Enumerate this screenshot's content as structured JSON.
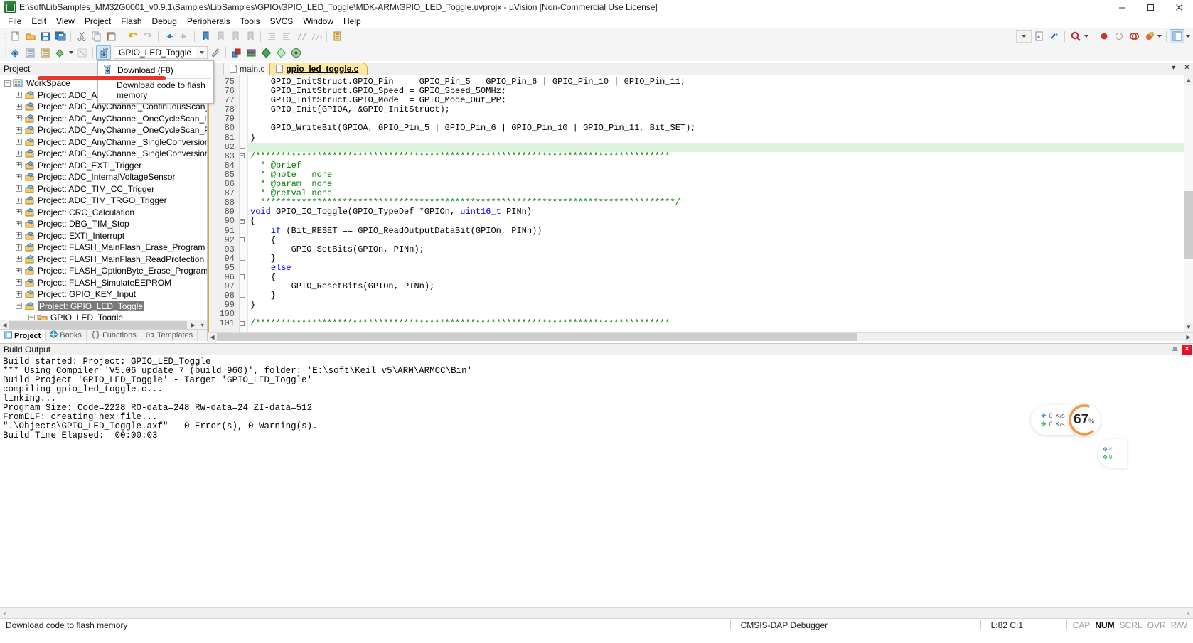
{
  "window": {
    "title": "E:\\soft\\LibSamples_MM32G0001_v0.9.1\\Samples\\LibSamples\\GPIO\\GPIO_LED_Toggle\\MDK-ARM\\GPIO_LED_Toggle.uvprojx - µVision  [Non-Commercial Use License]",
    "app_icon": "keil-uvision-icon",
    "minimize": "–",
    "maximize": "▭",
    "close": "✕"
  },
  "menu": {
    "items": [
      "File",
      "Edit",
      "View",
      "Project",
      "Flash",
      "Debug",
      "Peripherals",
      "Tools",
      "SVCS",
      "Window",
      "Help"
    ]
  },
  "toolbar": {
    "target_combo_value": "GPIO_LED_Toggle",
    "icons_row1": [
      "new-file-icon",
      "open-file-icon",
      "save-icon",
      "save-all-icon",
      "cut-icon",
      "copy-icon",
      "paste-icon",
      "undo-icon",
      "redo-icon",
      "navigate-back-icon",
      "navigate-forward-icon",
      "bookmark-toggle-icon",
      "bookmark-prev-icon",
      "bookmark-next-icon",
      "bookmark-clear-icon",
      "indent-icon",
      "outdent-icon",
      "comment-icon",
      "uncomment-icon",
      "configure-icon"
    ],
    "icons_row1_right": [
      "combo-dropdown",
      "insert-file-icon",
      "goto-definition-icon",
      "find-in-files-icon",
      "breakpoint-insert-icon",
      "breakpoint-disable-icon",
      "breakpoint-clear-all-icon",
      "breakpoint-disable-all-icon",
      "window-layout-icon"
    ],
    "icons_row2": [
      "translate-icon",
      "build-icon",
      "rebuild-icon",
      "batch-build-icon",
      "stop-build-icon",
      "download-icon"
    ],
    "icons_row2_right": [
      "target-options-icon",
      "manage-runtime-icon",
      "pack-installer-icon",
      "debug-settings-icon",
      "configure-wizard-icon",
      "options-icon"
    ]
  },
  "tooltip": {
    "title": "Download (F8)",
    "body": "Download code to flash memory",
    "icon": "download-icon",
    "annotation_color": "#e8352c"
  },
  "project_pane": {
    "header": "Project",
    "root": "WorkSpace",
    "root_icon": "workspace-icon",
    "nodes": [
      {
        "label": "Project: ADC_AnyChannel_ContinuousScan_Interrupt",
        "selected": false
      },
      {
        "label": "Project: ADC_AnyChannel_ContinuousScan_Polling",
        "selected": false
      },
      {
        "label": "Project: ADC_AnyChannel_OneCycleScan_Interrupt",
        "selected": false
      },
      {
        "label": "Project: ADC_AnyChannel_OneCycleScan_Polling",
        "selected": false
      },
      {
        "label": "Project: ADC_AnyChannel_SingleConversion_Interrupt",
        "selected": false
      },
      {
        "label": "Project: ADC_AnyChannel_SingleConversion_Polling",
        "selected": false
      },
      {
        "label": "Project: ADC_EXTI_Trigger",
        "selected": false
      },
      {
        "label": "Project: ADC_InternalVoltageSensor",
        "selected": false
      },
      {
        "label": "Project: ADC_TIM_CC_Trigger",
        "selected": false
      },
      {
        "label": "Project: ADC_TIM_TRGO_Trigger",
        "selected": false
      },
      {
        "label": "Project: CRC_Calculation",
        "selected": false
      },
      {
        "label": "Project: DBG_TIM_Stop",
        "selected": false
      },
      {
        "label": "Project: EXTI_Interrupt",
        "selected": false
      },
      {
        "label": "Project: FLASH_MainFlash_Erase_Program",
        "selected": false
      },
      {
        "label": "Project: FLASH_MainFlash_ReadProtection",
        "selected": false
      },
      {
        "label": "Project: FLASH_OptionByte_Erase_Program",
        "selected": false
      },
      {
        "label": "Project: FLASH_SimulateEEPROM",
        "selected": false
      },
      {
        "label": "Project: GPIO_KEY_Input",
        "selected": false
      },
      {
        "label": "Project: GPIO_LED_Toggle",
        "selected": true
      }
    ],
    "child_node": {
      "label": "GPIO_LED_Toggle",
      "icon": "folder-target-icon"
    },
    "tabs": [
      {
        "label": "Project",
        "icon": "project-icon",
        "selected": true
      },
      {
        "label": "Books",
        "icon": "books-icon",
        "selected": false
      },
      {
        "label": "Functions",
        "icon": "functions-icon",
        "selected": false
      },
      {
        "label": "Templates",
        "icon": "templates-icon",
        "selected": false
      }
    ]
  },
  "editor": {
    "tabs": [
      {
        "label": "main.c",
        "active": false
      },
      {
        "label": "gpio_led_toggle.c",
        "active": true
      }
    ],
    "first_line_number": 75,
    "lines": [
      {
        "n": 75,
        "fold": "",
        "text": "    GPIO_InitStruct.GPIO_Pin   = GPIO_Pin_5 | GPIO_Pin_6 | GPIO_Pin_10 | GPIO_Pin_11;",
        "hl": false
      },
      {
        "n": 76,
        "fold": "",
        "text": "    GPIO_InitStruct.GPIO_Speed = GPIO_Speed_50MHz;",
        "hl": false
      },
      {
        "n": 77,
        "fold": "",
        "text": "    GPIO_InitStruct.GPIO_Mode  = GPIO_Mode_Out_PP;",
        "hl": false
      },
      {
        "n": 78,
        "fold": "",
        "text": "    GPIO_Init(GPIOA, &GPIO_InitStruct);",
        "hl": false
      },
      {
        "n": 79,
        "fold": "",
        "text": "",
        "hl": false
      },
      {
        "n": 80,
        "fold": "",
        "text": "    GPIO_WriteBit(GPIOA, GPIO_Pin_5 | GPIO_Pin_6 | GPIO_Pin_10 | GPIO_Pin_11, Bit_SET);",
        "hl": false
      },
      {
        "n": 81,
        "fold": "",
        "text": "}",
        "hl": false
      },
      {
        "n": 82,
        "fold": "end",
        "text": "",
        "hl": true
      },
      {
        "n": 83,
        "fold": "minus",
        "text": "/*********************************************************************************",
        "hl": false
      },
      {
        "n": 84,
        "fold": "",
        "text": "  * @brief",
        "hl": false
      },
      {
        "n": 85,
        "fold": "",
        "text": "  * @note   none",
        "hl": false
      },
      {
        "n": 86,
        "fold": "",
        "text": "  * @param  none",
        "hl": false
      },
      {
        "n": 87,
        "fold": "",
        "text": "  * @retval none",
        "hl": false
      },
      {
        "n": 88,
        "fold": "end",
        "text": "  *********************************************************************************/",
        "hl": false
      },
      {
        "n": 89,
        "fold": "",
        "text": "void GPIO_IO_Toggle(GPIO_TypeDef *GPIOn, uint16_t PINn)",
        "hl": false
      },
      {
        "n": 90,
        "fold": "minus",
        "text": "{",
        "hl": false
      },
      {
        "n": 91,
        "fold": "",
        "text": "    if (Bit_RESET == GPIO_ReadOutputDataBit(GPIOn, PINn))",
        "hl": false
      },
      {
        "n": 92,
        "fold": "minus",
        "text": "    {",
        "hl": false
      },
      {
        "n": 93,
        "fold": "",
        "text": "        GPIO_SetBits(GPIOn, PINn);",
        "hl": false
      },
      {
        "n": 94,
        "fold": "end",
        "text": "    }",
        "hl": false
      },
      {
        "n": 95,
        "fold": "",
        "text": "    else",
        "hl": false
      },
      {
        "n": 96,
        "fold": "minus",
        "text": "    {",
        "hl": false
      },
      {
        "n": 97,
        "fold": "",
        "text": "        GPIO_ResetBits(GPIOn, PINn);",
        "hl": false
      },
      {
        "n": 98,
        "fold": "end",
        "text": "    }",
        "hl": false
      },
      {
        "n": 99,
        "fold": "",
        "text": "}",
        "hl": false
      },
      {
        "n": 100,
        "fold": "",
        "text": "",
        "hl": false
      },
      {
        "n": 101,
        "fold": "minus",
        "text": "/*********************************************************************************",
        "hl": false
      }
    ]
  },
  "build_output": {
    "header": "Build Output",
    "pin_icon": "pin-icon",
    "close_icon": "close-icon",
    "lines": [
      "Build started: Project: GPIO_LED_Toggle",
      "*** Using Compiler 'V5.06 update 7 (build 960)', folder: 'E:\\soft\\Keil_v5\\ARM\\ARMCC\\Bin'",
      "Build Project 'GPIO_LED_Toggle' - Target 'GPIO_LED_Toggle'",
      "compiling gpio_led_toggle.c...",
      "linking...",
      "Program Size: Code=2228 RO-data=248 RW-data=24 ZI-data=512",
      "FromELF: creating hex file...",
      "\".\\Objects\\GPIO_LED_Toggle.axf\" - 0 Error(s), 0 Warning(s).",
      "Build Time Elapsed:  00:00:03"
    ]
  },
  "status_bar": {
    "hint": "Download code to flash memory",
    "debugger": "CMSIS-DAP Debugger",
    "position": "L:82 C:1",
    "flags": [
      {
        "label": "CAP",
        "on": false
      },
      {
        "label": "NUM",
        "on": true
      },
      {
        "label": "SCRL",
        "on": false
      },
      {
        "label": "OVR",
        "on": false
      },
      {
        "label": "R/W",
        "on": false
      }
    ]
  },
  "net_widget": {
    "upload_value": "0",
    "upload_unit": "K/s",
    "download_value": "0",
    "download_unit": "K/s",
    "gauge_value": "67",
    "gauge_unit": "%",
    "gauge_color": "#f2994a",
    "upload_icon": "arrow-up-icon",
    "download_icon": "arrow-down-icon"
  }
}
